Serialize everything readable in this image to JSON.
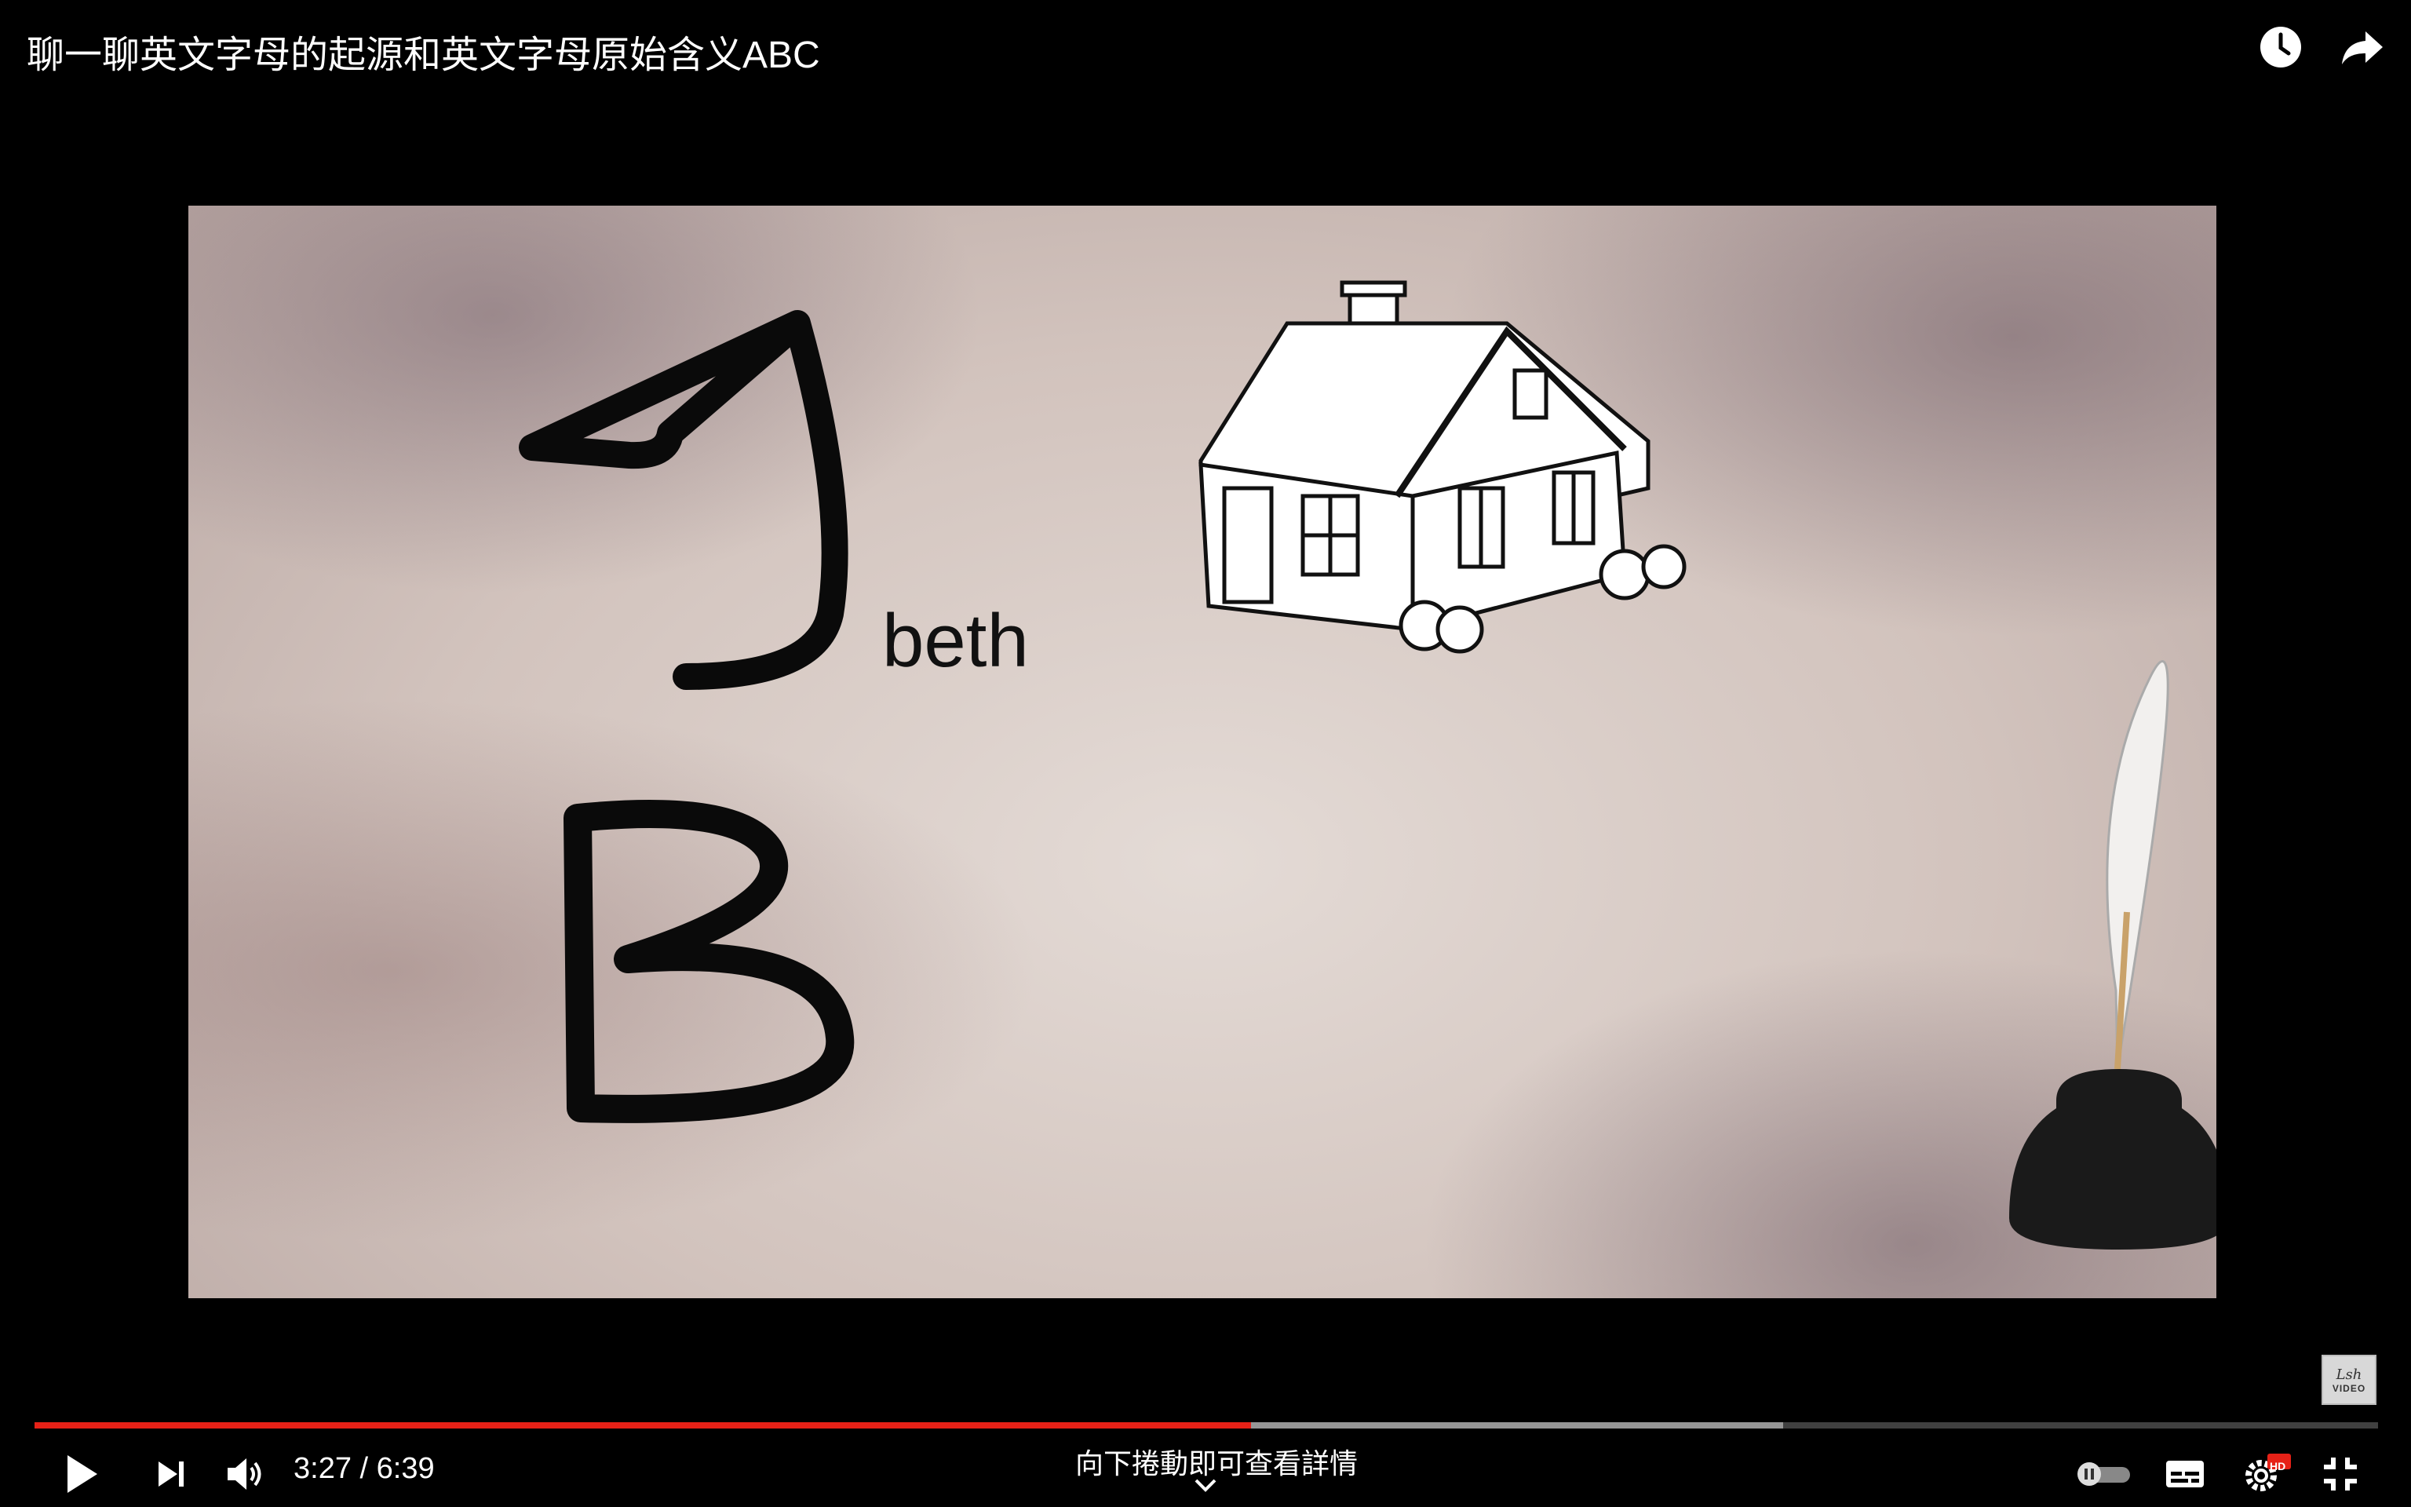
{
  "header": {
    "title": "聊一聊英文字母的起源和英文字母原始含义ABC",
    "icons": [
      "watch-later-icon",
      "share-icon"
    ]
  },
  "video": {
    "overlay_word": "beth",
    "logo_text_script": "Lsh",
    "logo_text_small": "VIDEO"
  },
  "player": {
    "current_time": "3:27",
    "duration": "6:39",
    "time_display": "3:27 / 6:39",
    "played_fraction": 0.519,
    "buffered_fraction": 0.746,
    "scroll_hint": "向下捲動即可查看詳情",
    "quality_badge": "HD",
    "icons": [
      "play-icon",
      "next-icon",
      "volume-icon",
      "autoplay-toggle-icon",
      "subtitles-icon",
      "settings-icon",
      "exit-fullscreen-icon",
      "chevron-down-icon"
    ],
    "accent_color": "#e62117"
  }
}
